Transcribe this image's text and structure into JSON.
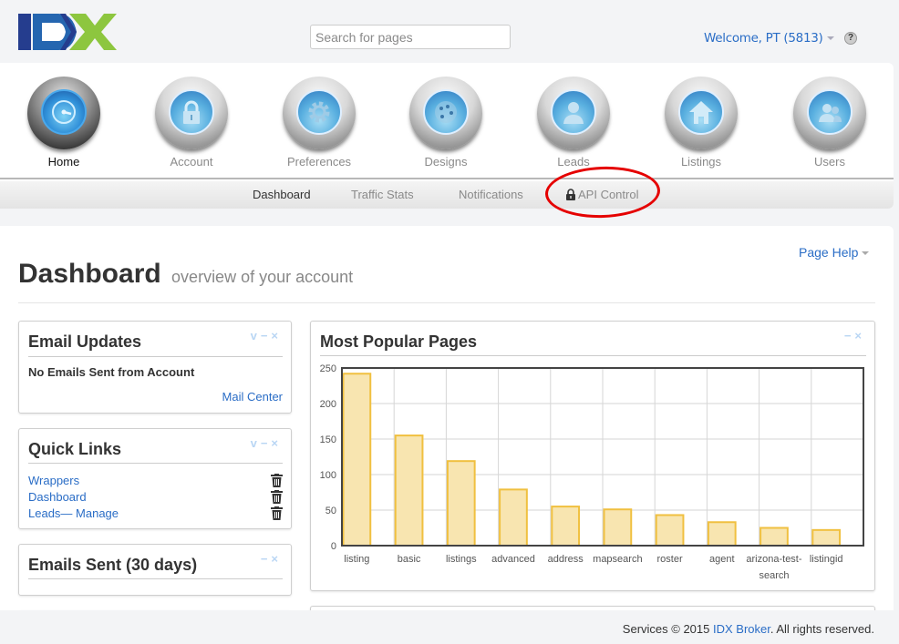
{
  "header": {
    "logo_text": "IDX",
    "search_placeholder": "Search for pages",
    "welcome": "Welcome, PT (5813)",
    "help_icon": "?"
  },
  "nav": {
    "items": [
      {
        "label": "Home",
        "icon": "speedometer-icon",
        "active": true
      },
      {
        "label": "Account",
        "icon": "lock-icon",
        "active": false
      },
      {
        "label": "Preferences",
        "icon": "gear-icon",
        "active": false
      },
      {
        "label": "Designs",
        "icon": "palette-icon",
        "active": false
      },
      {
        "label": "Leads",
        "icon": "person-icon",
        "active": false
      },
      {
        "label": "Listings",
        "icon": "house-icon",
        "active": false
      },
      {
        "label": "Users",
        "icon": "users-icon",
        "active": false
      }
    ],
    "subnav": [
      {
        "label": "Dashboard",
        "active": true
      },
      {
        "label": "Traffic Stats",
        "active": false
      },
      {
        "label": "Notifications",
        "active": false
      },
      {
        "label": "API Control",
        "active": false,
        "locked": true
      }
    ],
    "annotation_color": "#e50000"
  },
  "page": {
    "help": "Page Help",
    "title": "Dashboard",
    "subtitle": "overview of your account"
  },
  "widgets": {
    "email_updates": {
      "title": "Email Updates",
      "body": "No Emails Sent from Account",
      "link": "Mail Center",
      "controls": [
        "v",
        "−",
        "×"
      ]
    },
    "quick_links": {
      "title": "Quick Links",
      "links": [
        "Wrappers",
        "Dashboard",
        "Leads— Manage"
      ],
      "controls": [
        "v",
        "−",
        "×"
      ]
    },
    "emails_sent": {
      "title": "Emails Sent (30 days)",
      "controls": [
        "−",
        "×"
      ]
    },
    "popular_pages": {
      "title": "Most Popular Pages",
      "controls": [
        "−",
        "×"
      ]
    }
  },
  "chart_data": {
    "type": "bar",
    "title": "Most Popular Pages",
    "categories": [
      "listing",
      "basic",
      "listings",
      "advanced",
      "address",
      "mapsearch",
      "roster",
      "agent",
      "arizona-test-search",
      "listingid"
    ],
    "category_display": [
      [
        "listing"
      ],
      [
        "basic"
      ],
      [
        "listings"
      ],
      [
        "advanced"
      ],
      [
        "address"
      ],
      [
        "mapsearch"
      ],
      [
        "roster"
      ],
      [
        "agent"
      ],
      [
        "arizona-test-",
        "search"
      ],
      [
        "listingid"
      ]
    ],
    "values": [
      242,
      155,
      119,
      79,
      55,
      51,
      43,
      33,
      25,
      22
    ],
    "xlabel": "",
    "ylabel": "",
    "ylim": [
      0,
      250
    ],
    "yticks": [
      0,
      50,
      100,
      150,
      200,
      250
    ],
    "grid": true,
    "bar_fill": "#f8e5b0",
    "bar_stroke": "#f0c040"
  },
  "footer": {
    "prefix": "Services © 2015 ",
    "link": "IDX Broker",
    "suffix": ". All rights reserved."
  }
}
